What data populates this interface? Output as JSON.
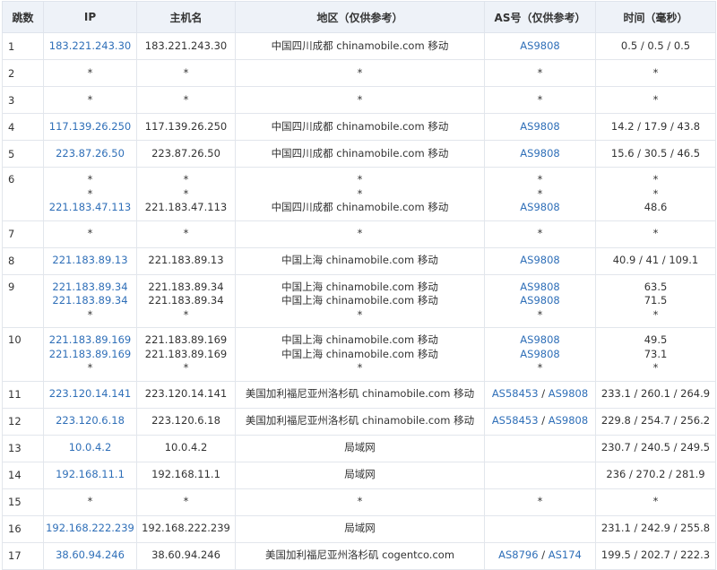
{
  "headers": [
    "跳数",
    "IP",
    "主机名",
    "地区（仅供参考）",
    "AS号（仅供参考）",
    "时间（毫秒）"
  ],
  "rows": [
    {
      "hop": "1",
      "lines": [
        {
          "ip": "183.221.243.30",
          "host": "183.221.243.30",
          "region": "中国四川成都 chinamobile.com 移动",
          "as": [
            "AS9808"
          ],
          "time": "0.5 / 0.5 / 0.5"
        }
      ]
    },
    {
      "hop": "2",
      "lines": [
        {
          "ip": "*",
          "host": "*",
          "region": "*",
          "as": [
            "*"
          ],
          "time": "*"
        }
      ]
    },
    {
      "hop": "3",
      "lines": [
        {
          "ip": "*",
          "host": "*",
          "region": "*",
          "as": [
            "*"
          ],
          "time": "*"
        }
      ]
    },
    {
      "hop": "4",
      "lines": [
        {
          "ip": "117.139.26.250",
          "host": "117.139.26.250",
          "region": "中国四川成都 chinamobile.com 移动",
          "as": [
            "AS9808"
          ],
          "time": "14.2 / 17.9 / 43.8"
        }
      ]
    },
    {
      "hop": "5",
      "lines": [
        {
          "ip": "223.87.26.50",
          "host": "223.87.26.50",
          "region": "中国四川成都 chinamobile.com 移动",
          "as": [
            "AS9808"
          ],
          "time": "15.6 / 30.5 / 46.5"
        }
      ]
    },
    {
      "hop": "6",
      "lines": [
        {
          "ip": "*",
          "host": "*",
          "region": "*",
          "as": [
            "*"
          ],
          "time": "*"
        },
        {
          "ip": "*",
          "host": "*",
          "region": "*",
          "as": [
            "*"
          ],
          "time": "*"
        },
        {
          "ip": "221.183.47.113",
          "host": "221.183.47.113",
          "region": "中国四川成都 chinamobile.com 移动",
          "as": [
            "AS9808"
          ],
          "time": "48.6"
        }
      ]
    },
    {
      "hop": "7",
      "lines": [
        {
          "ip": "*",
          "host": "*",
          "region": "*",
          "as": [
            "*"
          ],
          "time": "*"
        }
      ]
    },
    {
      "hop": "8",
      "lines": [
        {
          "ip": "221.183.89.13",
          "host": "221.183.89.13",
          "region": "中国上海 chinamobile.com 移动",
          "as": [
            "AS9808"
          ],
          "time": "40.9 / 41 / 109.1"
        }
      ]
    },
    {
      "hop": "9",
      "lines": [
        {
          "ip": "221.183.89.34",
          "host": "221.183.89.34",
          "region": "中国上海 chinamobile.com 移动",
          "as": [
            "AS9808"
          ],
          "time": "63.5"
        },
        {
          "ip": "221.183.89.34",
          "host": "221.183.89.34",
          "region": "中国上海 chinamobile.com 移动",
          "as": [
            "AS9808"
          ],
          "time": "71.5"
        },
        {
          "ip": "*",
          "host": "*",
          "region": "*",
          "as": [
            "*"
          ],
          "time": "*"
        }
      ]
    },
    {
      "hop": "10",
      "lines": [
        {
          "ip": "221.183.89.169",
          "host": "221.183.89.169",
          "region": "中国上海 chinamobile.com 移动",
          "as": [
            "AS9808"
          ],
          "time": "49.5"
        },
        {
          "ip": "221.183.89.169",
          "host": "221.183.89.169",
          "region": "中国上海 chinamobile.com 移动",
          "as": [
            "AS9808"
          ],
          "time": "73.1"
        },
        {
          "ip": "*",
          "host": "*",
          "region": "*",
          "as": [
            "*"
          ],
          "time": "*"
        }
      ]
    },
    {
      "hop": "11",
      "lines": [
        {
          "ip": "223.120.14.141",
          "host": "223.120.14.141",
          "region": "美国加利福尼亚州洛杉矶 chinamobile.com 移动",
          "as": [
            "AS58453",
            "AS9808"
          ],
          "time": "233.1 / 260.1 / 264.9"
        }
      ]
    },
    {
      "hop": "12",
      "lines": [
        {
          "ip": "223.120.6.18",
          "host": "223.120.6.18",
          "region": "美国加利福尼亚州洛杉矶 chinamobile.com 移动",
          "as": [
            "AS58453",
            "AS9808"
          ],
          "time": "229.8 / 254.7 / 256.2"
        }
      ]
    },
    {
      "hop": "13",
      "lines": [
        {
          "ip": "10.0.4.2",
          "host": "10.0.4.2",
          "region": "局域网",
          "as": [],
          "time": "230.7 / 240.5 / 249.5"
        }
      ]
    },
    {
      "hop": "14",
      "lines": [
        {
          "ip": "192.168.11.1",
          "host": "192.168.11.1",
          "region": "局域网",
          "as": [],
          "time": "236 / 270.2 / 281.9"
        }
      ]
    },
    {
      "hop": "15",
      "lines": [
        {
          "ip": "*",
          "host": "*",
          "region": "*",
          "as": [
            "*"
          ],
          "time": "*"
        }
      ]
    },
    {
      "hop": "16",
      "lines": [
        {
          "ip": "192.168.222.239",
          "host": "192.168.222.239",
          "region": "局域网",
          "as": [],
          "time": "231.1 / 242.9 / 255.8"
        }
      ]
    },
    {
      "hop": "17",
      "lines": [
        {
          "ip": "38.60.94.246",
          "host": "38.60.94.246",
          "region": "美国加利福尼亚州洛杉矶 cogentco.com",
          "as": [
            "AS8796",
            "AS174"
          ],
          "time": "199.5 / 202.7 / 222.3"
        }
      ]
    }
  ],
  "colors": {
    "link": "#2f6fb8",
    "header_bg": "#eef2f8",
    "border": "#e2e6ec"
  }
}
